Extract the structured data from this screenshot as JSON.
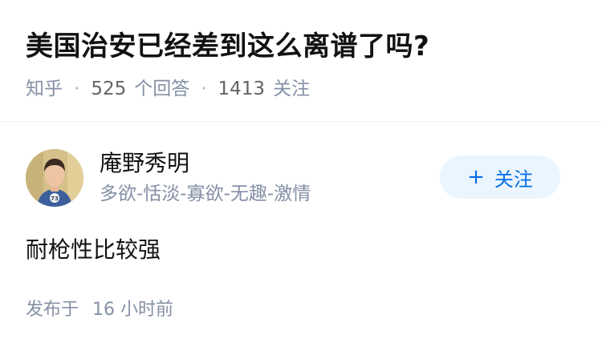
{
  "question": {
    "title": "美国治安已经差到这么离谱了吗?",
    "source": "知乎",
    "answers_count": "525",
    "answers_label": "个回答",
    "followers_count": "1413",
    "followers_label": "关注"
  },
  "answer": {
    "author": {
      "name": "庵野秀明",
      "bio": "多欲-恬淡-寡欲-无趣-激情",
      "avatar_icon": "user-avatar-photo"
    },
    "follow_button": {
      "icon": "plus-icon",
      "label": "关注",
      "accent_color": "#056de8",
      "background": "#ebf5fd"
    },
    "content": "耐枪性比较强",
    "time_label": "发布于",
    "time_value": "16 小时前"
  }
}
